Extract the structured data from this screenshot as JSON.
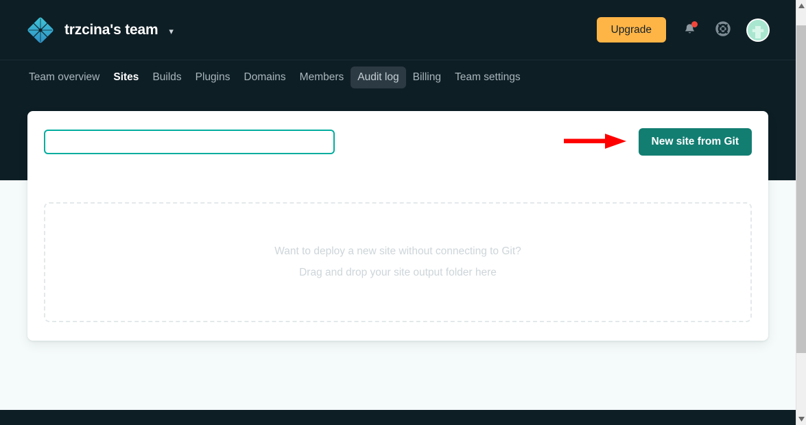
{
  "header": {
    "logo_icon": "netlify-diamond-logo",
    "team_name": "trzcina's team",
    "team_dropdown_icon": "chevron-down-icon",
    "upgrade_label": "Upgrade",
    "notifications_icon": "bell-icon",
    "has_unread_notifications": true,
    "help_icon": "lifebuoy-icon",
    "avatar_icon": "user-avatar"
  },
  "nav": {
    "items": [
      {
        "label": "Team overview",
        "state": "default"
      },
      {
        "label": "Sites",
        "state": "active"
      },
      {
        "label": "Builds",
        "state": "default"
      },
      {
        "label": "Plugins",
        "state": "default"
      },
      {
        "label": "Domains",
        "state": "default"
      },
      {
        "label": "Members",
        "state": "default"
      },
      {
        "label": "Audit log",
        "state": "hovered"
      },
      {
        "label": "Billing",
        "state": "default"
      },
      {
        "label": "Team settings",
        "state": "default"
      }
    ]
  },
  "card": {
    "search": {
      "value": "",
      "placeholder": ""
    },
    "new_site_button": "New site from Git",
    "dropzone": {
      "line1": "Want to deploy a new site without connecting to Git?",
      "line2": "Drag and drop your site output folder here"
    }
  },
  "annotation": {
    "arrow_icon": "red-arrow-right",
    "color": "#ff0000",
    "points_to": "New site from Git"
  },
  "colors": {
    "dark_header": "#0e1e25",
    "page_background": "#f5fafa",
    "card_background": "#ffffff",
    "accent_teal": "#00ad9f",
    "primary_button": "#127e72",
    "upgrade_orange": "#ffb546",
    "notification_red": "#f4453b",
    "annotation_red": "#ff0000"
  },
  "scrollbar": {
    "up_arrow_icon": "triangle-up-icon",
    "down_arrow_icon": "triangle-down-icon",
    "orientation": "vertical"
  }
}
